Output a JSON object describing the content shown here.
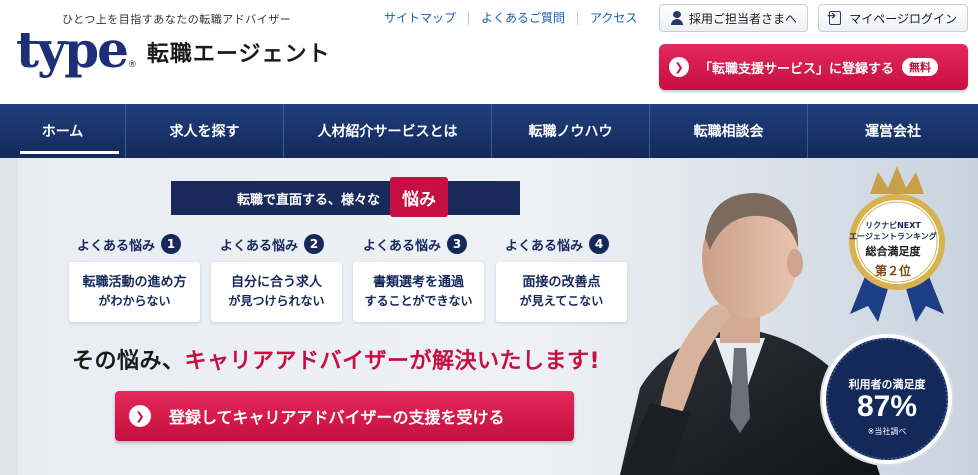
{
  "header": {
    "tagline": "ひとつ上を目指すあなたの転職アドバイザー",
    "logo_text": "type",
    "logo_reg": "®",
    "logo_sub": "転職エージェント",
    "util_links": [
      "サイトマップ",
      "よくあるご質問",
      "アクセス"
    ],
    "staff_button": "採用ご担当者さまへ",
    "login_button": "マイページログイン",
    "register_button": "「転職支援サービス」に登録する",
    "register_badge": "無料"
  },
  "nav": {
    "items": [
      "ホーム",
      "求人を探す",
      "人材紹介サービスとは",
      "転職ノウハウ",
      "転職相談会",
      "運営会社"
    ],
    "active_index": 0
  },
  "hero": {
    "trouble_heading": "転職で直面する、様々な",
    "trouble_badge": "悩み",
    "worries": [
      {
        "label": "よくある悩み",
        "num": "1",
        "line1": "転職活動の進め方",
        "line2": "がわからない"
      },
      {
        "label": "よくある悩み",
        "num": "2",
        "line1": "自分に合う求人",
        "line2": "が見つけられない"
      },
      {
        "label": "よくある悩み",
        "num": "3",
        "line1": "書類選考を通過",
        "line2": "することができない"
      },
      {
        "label": "よくある悩み",
        "num": "4",
        "line1": "面接の改善点",
        "line2": "が見えてこない"
      }
    ],
    "headline_prefix": "その悩み、",
    "headline_accent": "キャリアアドバイザーが解決いたします!",
    "cta_button": "登録してキャリアアドバイザーの支援を受ける"
  },
  "award": {
    "line1": "リクナビNEXT",
    "line2": "エージェントランキング",
    "line3": "総合満足度",
    "rank": "第２位"
  },
  "satisfaction": {
    "label": "利用者の満足度",
    "value": "87%",
    "note": "※当社調べ",
    "percent": 87
  },
  "colors": {
    "navy": "#15285a",
    "brand_blue": "#1c2f78",
    "accent_red": "#c60f43",
    "link_blue": "#1c5fb0"
  }
}
